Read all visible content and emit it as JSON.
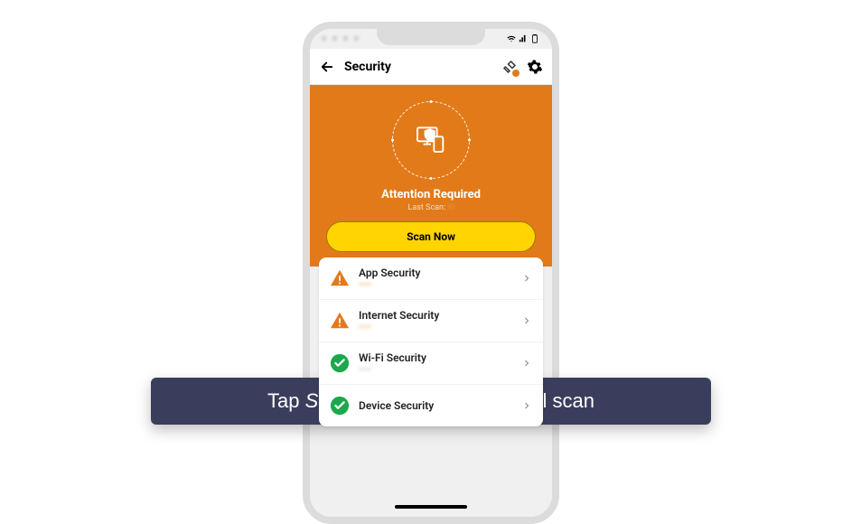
{
  "status_bar": {
    "time": "• • • •"
  },
  "header": {
    "title": "Security"
  },
  "hero": {
    "title": "Attention Required",
    "lastscan_prefix": "Last Scan: ",
    "lastscan_value": "—",
    "scan_button": "Scan Now"
  },
  "rows": [
    {
      "icon": "warning",
      "title": "App Security",
      "sub": "——",
      "sub_class": "orange"
    },
    {
      "icon": "warning",
      "title": "Internet Security",
      "sub": "——",
      "sub_class": "orange"
    },
    {
      "icon": "check",
      "title": "Wi-Fi Security",
      "sub": "——",
      "sub_class": "grey"
    },
    {
      "icon": "check",
      "title": "Device Security",
      "sub": "",
      "sub_class": "grey"
    }
  ],
  "caption": {
    "pre": "Tap ",
    "em": "Scan Now",
    "post": " to begin your full scan"
  }
}
